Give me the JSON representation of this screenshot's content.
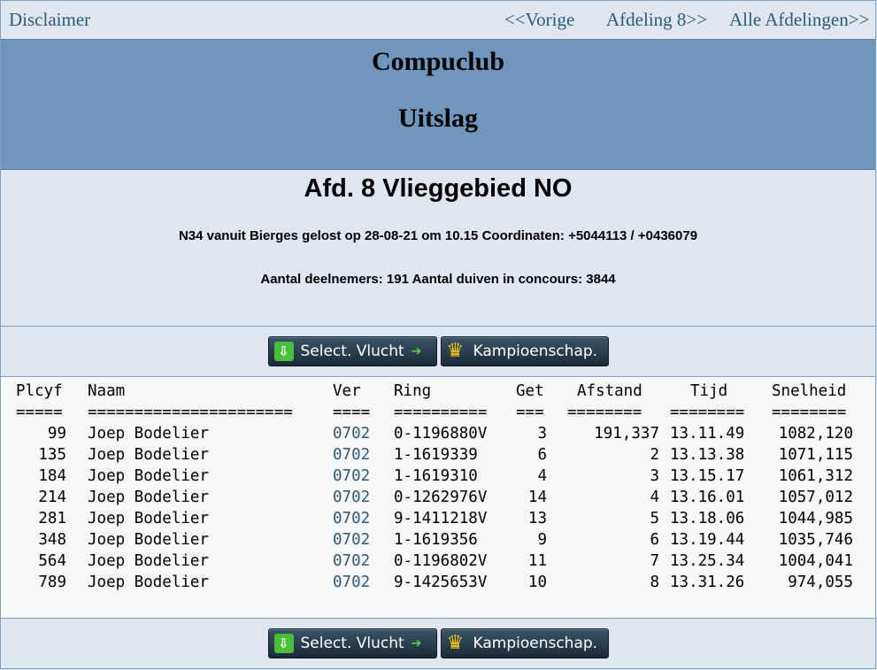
{
  "nav": {
    "disclaimer": "Disclaimer",
    "prev": "<<Vorige",
    "next": "Afdeling 8>>",
    "all": "Alle Afdelingen>>"
  },
  "banner": {
    "club": "Compuclub",
    "subtitle": "Uitslag"
  },
  "info": {
    "section": "Afd. 8 Vlieggebied NO",
    "release": "N34 vanuit Bierges gelost op 28-08-21 om 10.15 Coordinaten: +5044113 / +0436079",
    "counts": "Aantal deelnemers: 191 Aantal duiven in concours: 3844"
  },
  "buttons": {
    "select_flight": "Select. Vlucht",
    "championship": "Kampioenschap."
  },
  "table": {
    "headers": [
      "Plcyf",
      "Naam",
      "Ver",
      "Ring",
      "Get",
      "Afstand",
      "Tijd",
      "Snelheid"
    ],
    "separators": [
      "=====",
      "======================",
      "====",
      "==========",
      "===",
      "========",
      "========",
      "========"
    ],
    "rows": [
      {
        "plcyf": "99",
        "naam": "Joep Bodelier",
        "ver": "0702",
        "ring": "0-1196880V",
        "get": "3",
        "afstand": "191,337",
        "tijd": "13.11.49",
        "snelheid": "1082,120"
      },
      {
        "plcyf": "135",
        "naam": "Joep Bodelier",
        "ver": "0702",
        "ring": "1-1619339",
        "get": "6",
        "afstand": "2",
        "tijd": "13.13.38",
        "snelheid": "1071,115"
      },
      {
        "plcyf": "184",
        "naam": "Joep Bodelier",
        "ver": "0702",
        "ring": "1-1619310",
        "get": "4",
        "afstand": "3",
        "tijd": "13.15.17",
        "snelheid": "1061,312"
      },
      {
        "plcyf": "214",
        "naam": "Joep Bodelier",
        "ver": "0702",
        "ring": "0-1262976V",
        "get": "14",
        "afstand": "4",
        "tijd": "13.16.01",
        "snelheid": "1057,012"
      },
      {
        "plcyf": "281",
        "naam": "Joep Bodelier",
        "ver": "0702",
        "ring": "9-1411218V",
        "get": "13",
        "afstand": "5",
        "tijd": "13.18.06",
        "snelheid": "1044,985"
      },
      {
        "plcyf": "348",
        "naam": "Joep Bodelier",
        "ver": "0702",
        "ring": "1-1619356",
        "get": "9",
        "afstand": "6",
        "tijd": "13.19.44",
        "snelheid": "1035,746"
      },
      {
        "plcyf": "564",
        "naam": "Joep Bodelier",
        "ver": "0702",
        "ring": "0-1196802V",
        "get": "11",
        "afstand": "7",
        "tijd": "13.25.34",
        "snelheid": "1004,041"
      },
      {
        "plcyf": "789",
        "naam": "Joep Bodelier",
        "ver": "0702",
        "ring": "9-1425653V",
        "get": "10",
        "afstand": "8",
        "tijd": "13.31.26",
        "snelheid": "974,055"
      }
    ]
  }
}
